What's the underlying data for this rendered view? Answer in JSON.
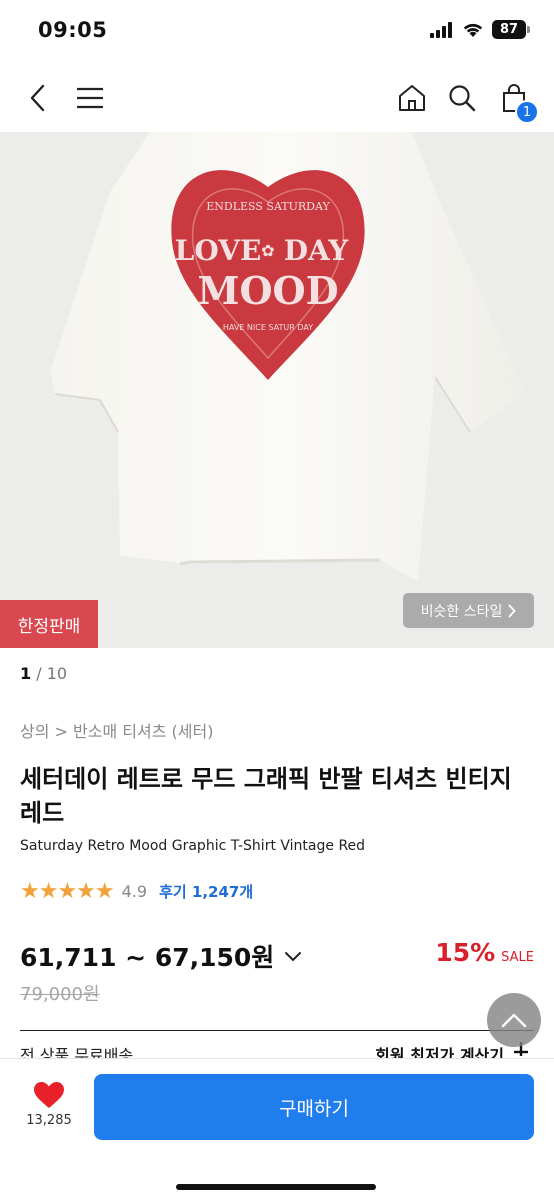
{
  "status_bar": {
    "time": "09:05",
    "battery": "87"
  },
  "nav": {
    "cart_count": "1"
  },
  "hero": {
    "print_lines": [
      "ENDLESS SATURDAY",
      "LOVE",
      "DAY",
      "MOOD",
      "HAVE NICE SATUR DAY"
    ],
    "limited_badge": "한정판매",
    "similar_style": "비슷한 스타일"
  },
  "pager": {
    "current": "1",
    "total": " / 10"
  },
  "breadcrumb": "상의 > 반소매 티셔츠 (세터)",
  "product": {
    "title": "세터데이 레트로 무드 그래픽 반팔 티셔츠 빈티지 레드",
    "subtitle": "Saturday Retro Mood Graphic T-Shirt Vintage Red"
  },
  "rating": {
    "stars": "★★★★★",
    "value": "4.9",
    "reviews": "후기 1,247개"
  },
  "price": {
    "range": "61,711 ~ 67,150원",
    "discount_rate": "15%",
    "sale_label": "SALE",
    "original": "79,000원"
  },
  "shipping": {
    "left": "전 상품 무료배송",
    "right": "회원 최저가 계산기"
  },
  "bottom": {
    "like_count": "13,285",
    "buy_label": "구매하기"
  },
  "colors": {
    "accent": "#1f7ded",
    "sale": "#d91f2a",
    "badge": "#d9484f",
    "star": "#f3a23a",
    "heart": "#e8202a"
  }
}
